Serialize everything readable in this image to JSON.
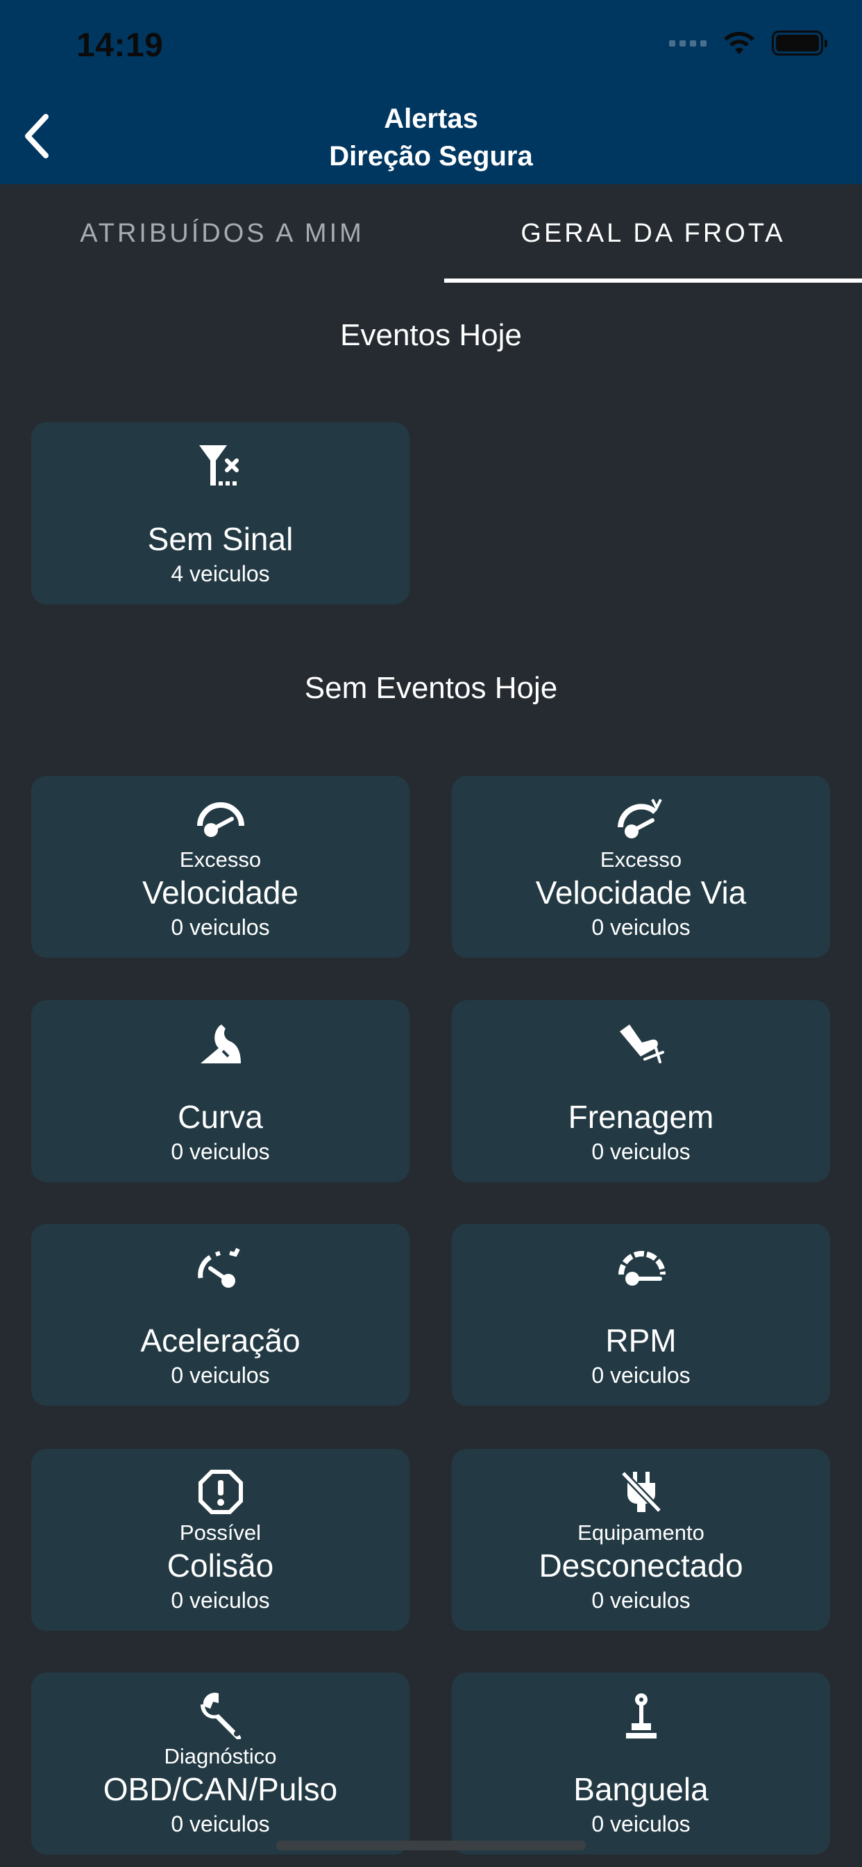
{
  "status_bar": {
    "time": "14:19"
  },
  "header": {
    "title_line1": "Alertas",
    "title_line2": "Direção Segura"
  },
  "tabs": [
    {
      "label": "ATRIBUÍDOS A MIM",
      "active": false
    },
    {
      "label": "GERAL DA FROTA",
      "active": true
    }
  ],
  "sections": {
    "events_today": "Eventos Hoje",
    "no_events_today": "Sem Eventos Hoje"
  },
  "events_today_cards": [
    {
      "icon": "no-signal-icon",
      "prefix": "",
      "name": "Sem Sinal",
      "count": "4 veiculos"
    }
  ],
  "no_events_cards": [
    {
      "icon": "speedometer-icon",
      "prefix": "Excesso",
      "name": "Velocidade",
      "count": "0 veiculos"
    },
    {
      "icon": "speedometer-road-icon",
      "prefix": "Excesso",
      "name": "Velocidade Via",
      "count": "0 veiculos"
    },
    {
      "icon": "curve-icon",
      "prefix": "",
      "name": "Curva",
      "count": "0 veiculos"
    },
    {
      "icon": "brake-pedal-icon",
      "prefix": "",
      "name": "Frenagem",
      "count": "0 veiculos"
    },
    {
      "icon": "acceleration-gauge-icon",
      "prefix": "",
      "name": "Aceleração",
      "count": "0 veiculos"
    },
    {
      "icon": "rpm-gauge-icon",
      "prefix": "",
      "name": "RPM",
      "count": "0 veiculos"
    },
    {
      "icon": "collision-warning-icon",
      "prefix": "Possível",
      "name": "Colisão",
      "count": "0 veiculos"
    },
    {
      "icon": "unplugged-icon",
      "prefix": "Equipamento",
      "name": "Desconectado",
      "count": "0 veiculos"
    },
    {
      "icon": "wrench-icon",
      "prefix": "Diagnóstico",
      "name": "OBD/CAN/Pulso",
      "count": "0 veiculos"
    },
    {
      "icon": "gear-stick-icon",
      "prefix": "",
      "name": "Banguela",
      "count": "0 veiculos"
    }
  ],
  "colors": {
    "header_bg": "#003760",
    "page_bg": "#252b31",
    "card_bg": "#233a44",
    "text": "#ffffff",
    "inactive_tab": "#a7acb2"
  }
}
